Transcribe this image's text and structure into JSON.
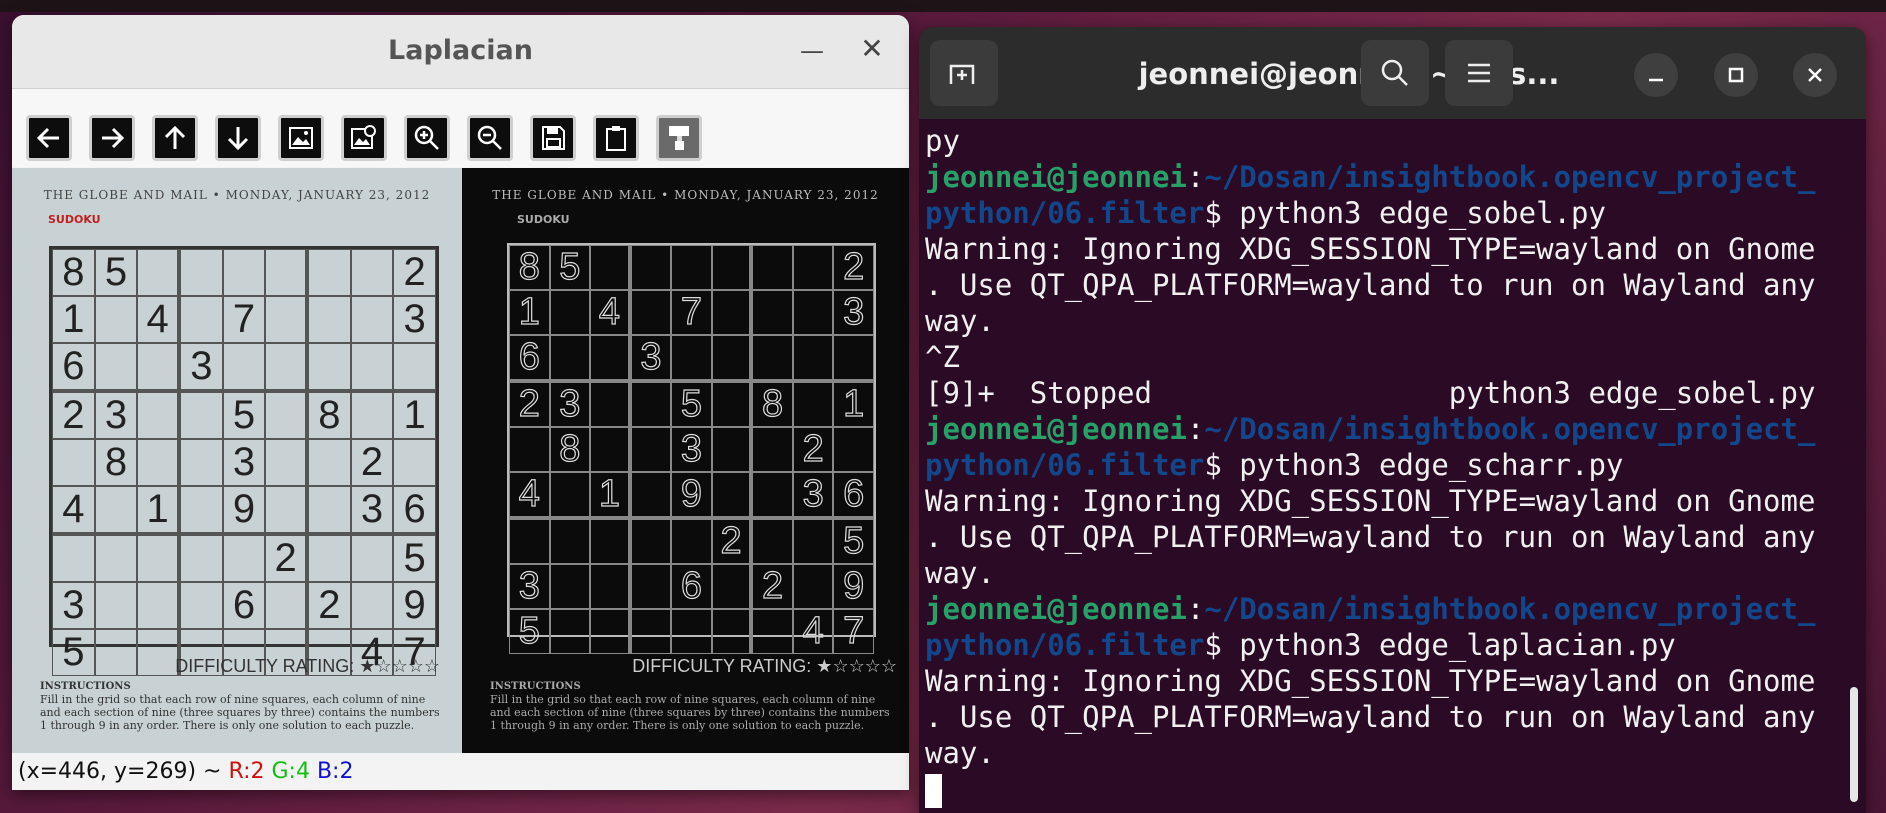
{
  "laplacian_window": {
    "title": "Laplacian",
    "minimize_label": "_",
    "close_label": "×",
    "toolbar": [
      "arrow-left",
      "arrow-right",
      "arrow-up",
      "arrow-down",
      "image",
      "image-zoom",
      "zoom-in",
      "zoom-out",
      "save",
      "clipboard",
      "paint"
    ],
    "status": {
      "coords": "(x=446, y=269) ~ ",
      "r": "R:2",
      "g": "G:4",
      "b": "B:2"
    },
    "image": {
      "header": "THE GLOBE AND MAIL  •  MONDAY, JANUARY 23, 2012",
      "section": "SUDOKU",
      "difficulty": "DIFFICULTY RATING: ★☆☆☆☆",
      "instructions_title": "INSTRUCTIONS",
      "instructions_text": "Fill in the grid so that each row of nine squares, each column of nine and each section of nine (three squares by three) contains the numbers 1 through 9 in any order. There is only one solution to each puzzle.",
      "grid": [
        [
          "8",
          "5",
          "",
          "",
          "",
          "",
          "",
          "",
          "2"
        ],
        [
          "1",
          "",
          "4",
          "",
          "7",
          "",
          "",
          "",
          "3"
        ],
        [
          "6",
          "",
          "",
          "3",
          "",
          "",
          "",
          "",
          ""
        ],
        [
          "2",
          "3",
          "",
          "",
          "5",
          "",
          "8",
          "",
          "1"
        ],
        [
          "",
          "8",
          "",
          "",
          "3",
          "",
          "",
          "2",
          ""
        ],
        [
          "4",
          "",
          "1",
          "",
          "9",
          "",
          "",
          "3",
          "6"
        ],
        [
          "",
          "",
          "",
          "",
          "",
          "2",
          "",
          "",
          "5"
        ],
        [
          "3",
          "",
          "",
          "",
          "6",
          "",
          "2",
          "",
          "9"
        ],
        [
          "5",
          "",
          "",
          "",
          "",
          "",
          "",
          "4",
          "7"
        ]
      ]
    }
  },
  "terminal": {
    "title": "jeonnei@jeonnei: ~/Dos...",
    "lines": [
      {
        "type": "text",
        "text": "py"
      },
      {
        "type": "prompt",
        "user": "jeonnei@jeonnei",
        "sep": ":",
        "path": "~/Dosan/insightbook.opencv_project_"
      },
      {
        "type": "promptcont",
        "path": "python/06.filter",
        "cmd": "$ python3 edge_sobel.py"
      },
      {
        "type": "text",
        "text": "Warning: Ignoring XDG_SESSION_TYPE=wayland on Gnome"
      },
      {
        "type": "text",
        "text": ". Use QT_QPA_PLATFORM=wayland to run on Wayland any"
      },
      {
        "type": "text",
        "text": "way."
      },
      {
        "type": "text",
        "text": "^Z"
      },
      {
        "type": "text",
        "text": "[9]+  Stopped                 python3 edge_sobel.py"
      },
      {
        "type": "prompt",
        "user": "jeonnei@jeonnei",
        "sep": ":",
        "path": "~/Dosan/insightbook.opencv_project_"
      },
      {
        "type": "promptcont",
        "path": "python/06.filter",
        "cmd": "$ python3 edge_scharr.py"
      },
      {
        "type": "text",
        "text": "Warning: Ignoring XDG_SESSION_TYPE=wayland on Gnome"
      },
      {
        "type": "text",
        "text": ". Use QT_QPA_PLATFORM=wayland to run on Wayland any"
      },
      {
        "type": "text",
        "text": "way."
      },
      {
        "type": "prompt",
        "user": "jeonnei@jeonnei",
        "sep": ":",
        "path": "~/Dosan/insightbook.opencv_project_"
      },
      {
        "type": "promptcont",
        "path": "python/06.filter",
        "cmd": "$ python3 edge_laplacian.py"
      },
      {
        "type": "text",
        "text": "Warning: Ignoring XDG_SESSION_TYPE=wayland on Gnome"
      },
      {
        "type": "text",
        "text": ". Use QT_QPA_PLATFORM=wayland to run on Wayland any"
      },
      {
        "type": "text",
        "text": "way."
      },
      {
        "type": "cursor"
      }
    ]
  }
}
